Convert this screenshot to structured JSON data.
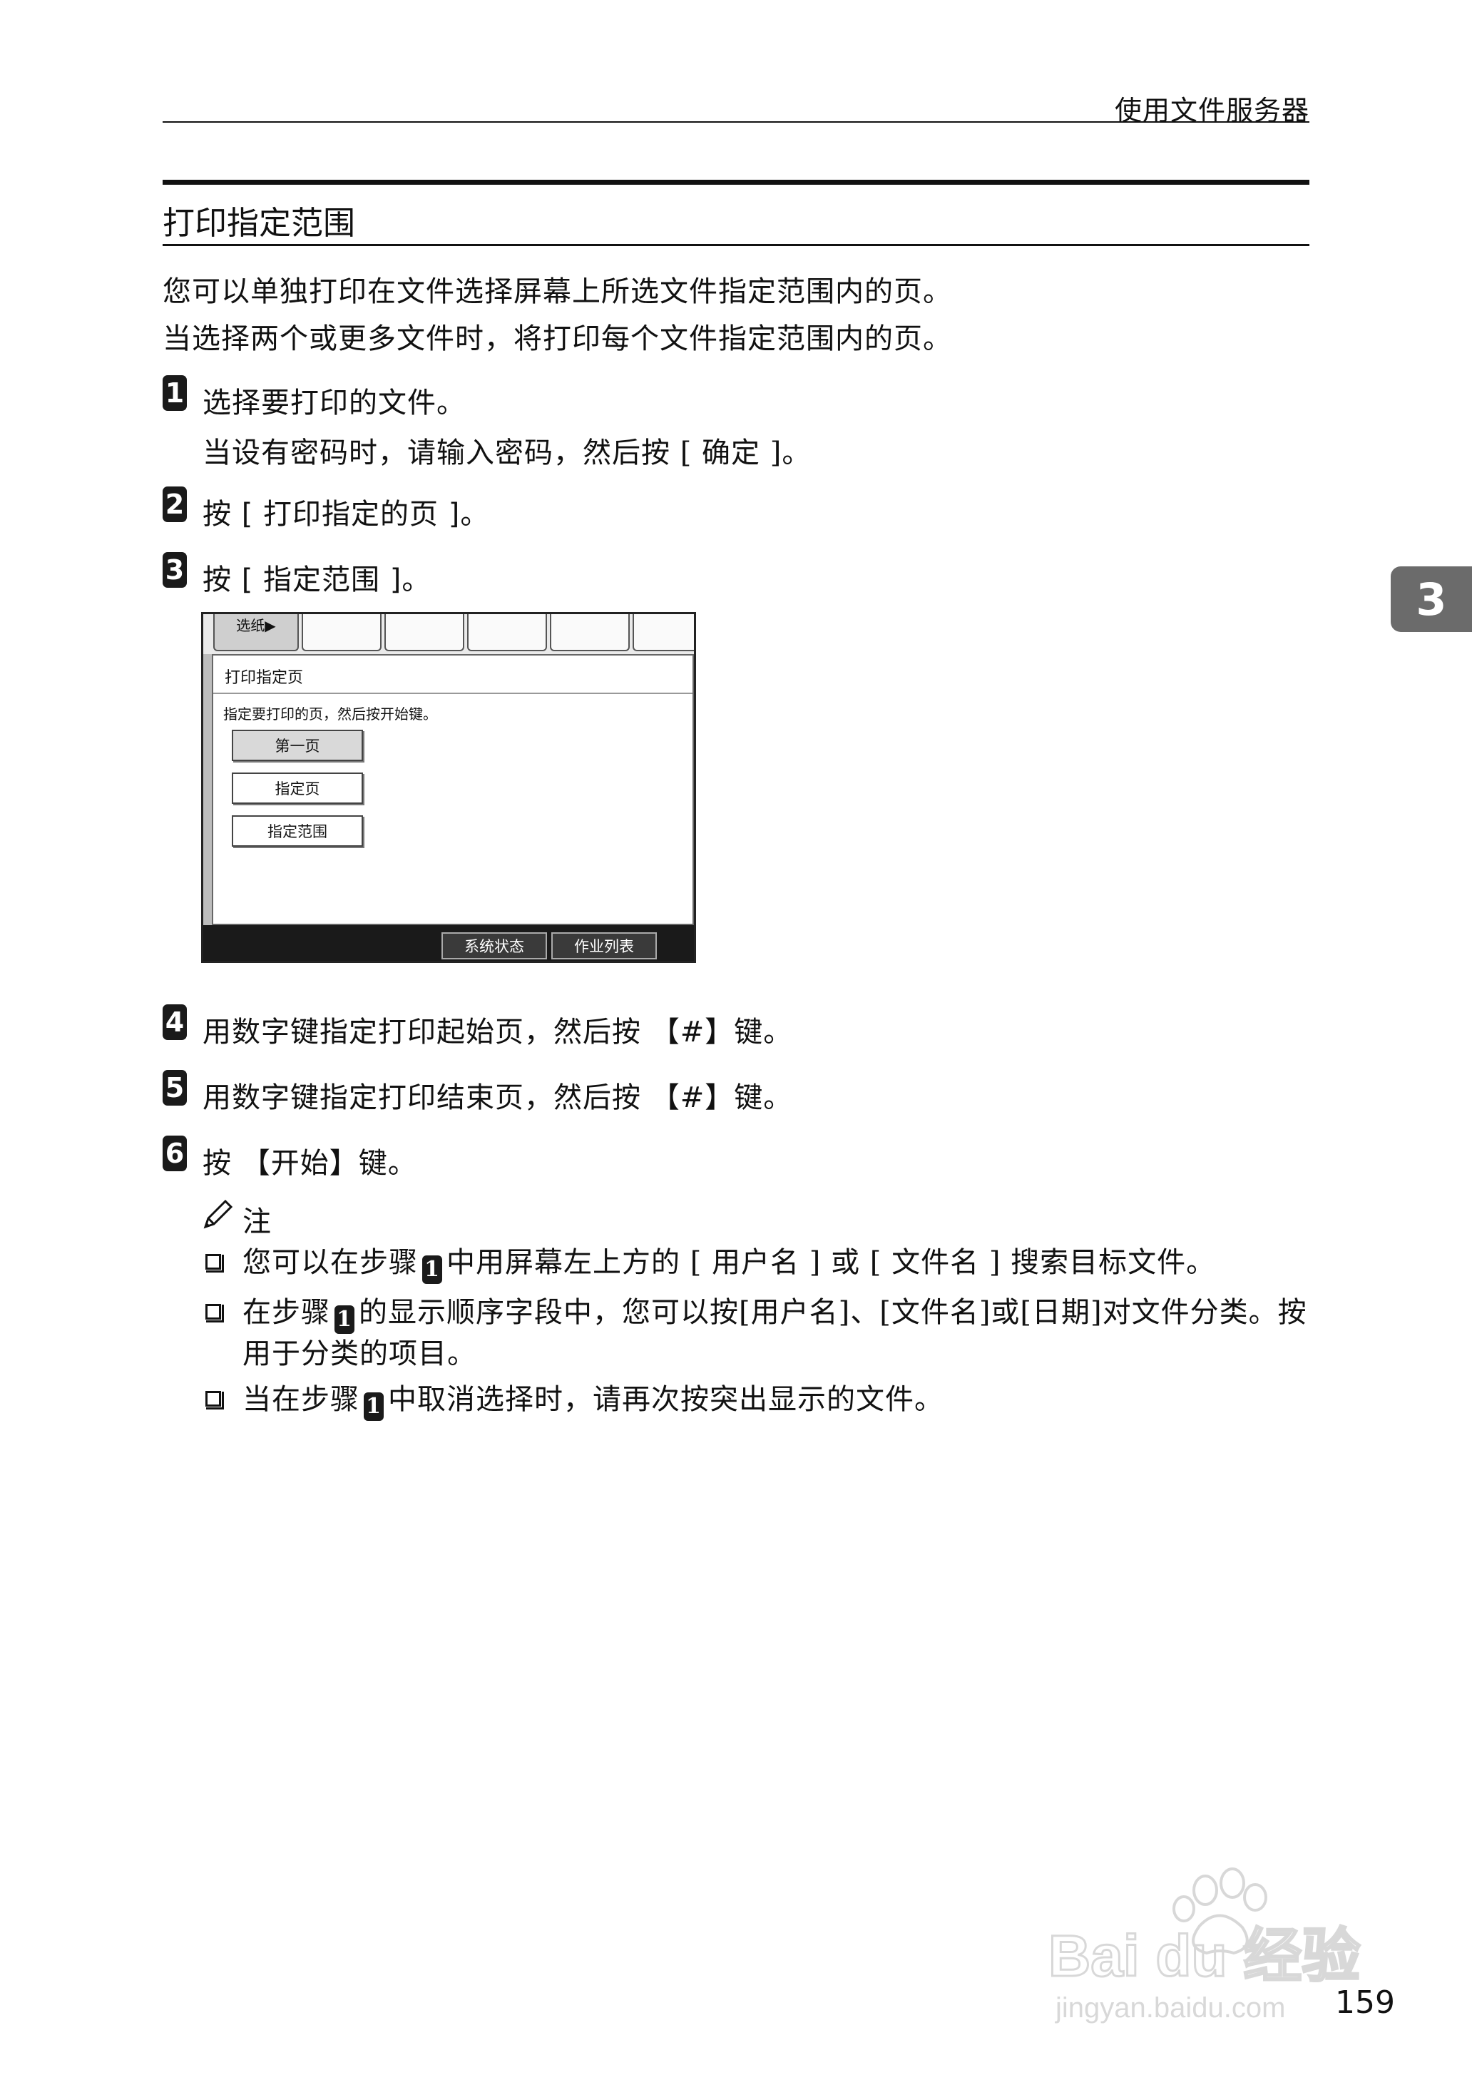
{
  "header": {
    "running_title": "使用文件服务器"
  },
  "chapter_tab": "3",
  "section": {
    "title": "打印指定范围",
    "intro": [
      "您可以单独打印在文件选择屏幕上所选文件指定范围内的页。",
      "当选择两个或更多文件时，将打印每个文件指定范围内的页。"
    ]
  },
  "steps": [
    {
      "num": "1",
      "text": "选择要打印的文件。",
      "sub": "当设有密码时，请输入密码，然后按 [ 确定 ]。"
    },
    {
      "num": "2",
      "text": "按 [ 打印指定的页 ]。"
    },
    {
      "num": "3",
      "text": "按 [ 指定范围 ]。"
    },
    {
      "num": "4",
      "text": "用数字键指定打印起始页，然后按 【#】键。"
    },
    {
      "num": "5",
      "text": "用数字键指定打印结束页，然后按 【#】键。"
    },
    {
      "num": "6",
      "text": "按 【开始】键。"
    }
  ],
  "screen": {
    "first_tab": "选纸▶",
    "title": "打印指定页",
    "instruction": "指定要打印的页，然后按开始键。",
    "buttons": [
      "第一页",
      "指定页",
      "指定范围"
    ],
    "status_buttons": [
      "系统状态",
      "作业列表"
    ]
  },
  "note": {
    "label": "注",
    "items": [
      {
        "before": "您可以在步骤",
        "step": "1",
        "after": "中用屏幕左上方的 [ 用户名 ] 或 [ 文件名 ] 搜索目标文件。"
      },
      {
        "before": "在步骤",
        "step": "1",
        "after": "的显示顺序字段中，您可以按[用户名]、[文件名]或[日期]对文件分类。按用于分类的项目。"
      },
      {
        "before": "当在步骤",
        "step": "1",
        "after": "中取消选择时，请再次按突出显示的文件。"
      }
    ]
  },
  "watermark": {
    "brand": "Bai du 经验",
    "url": "jingyan.baidu.com"
  },
  "page_number": "159"
}
